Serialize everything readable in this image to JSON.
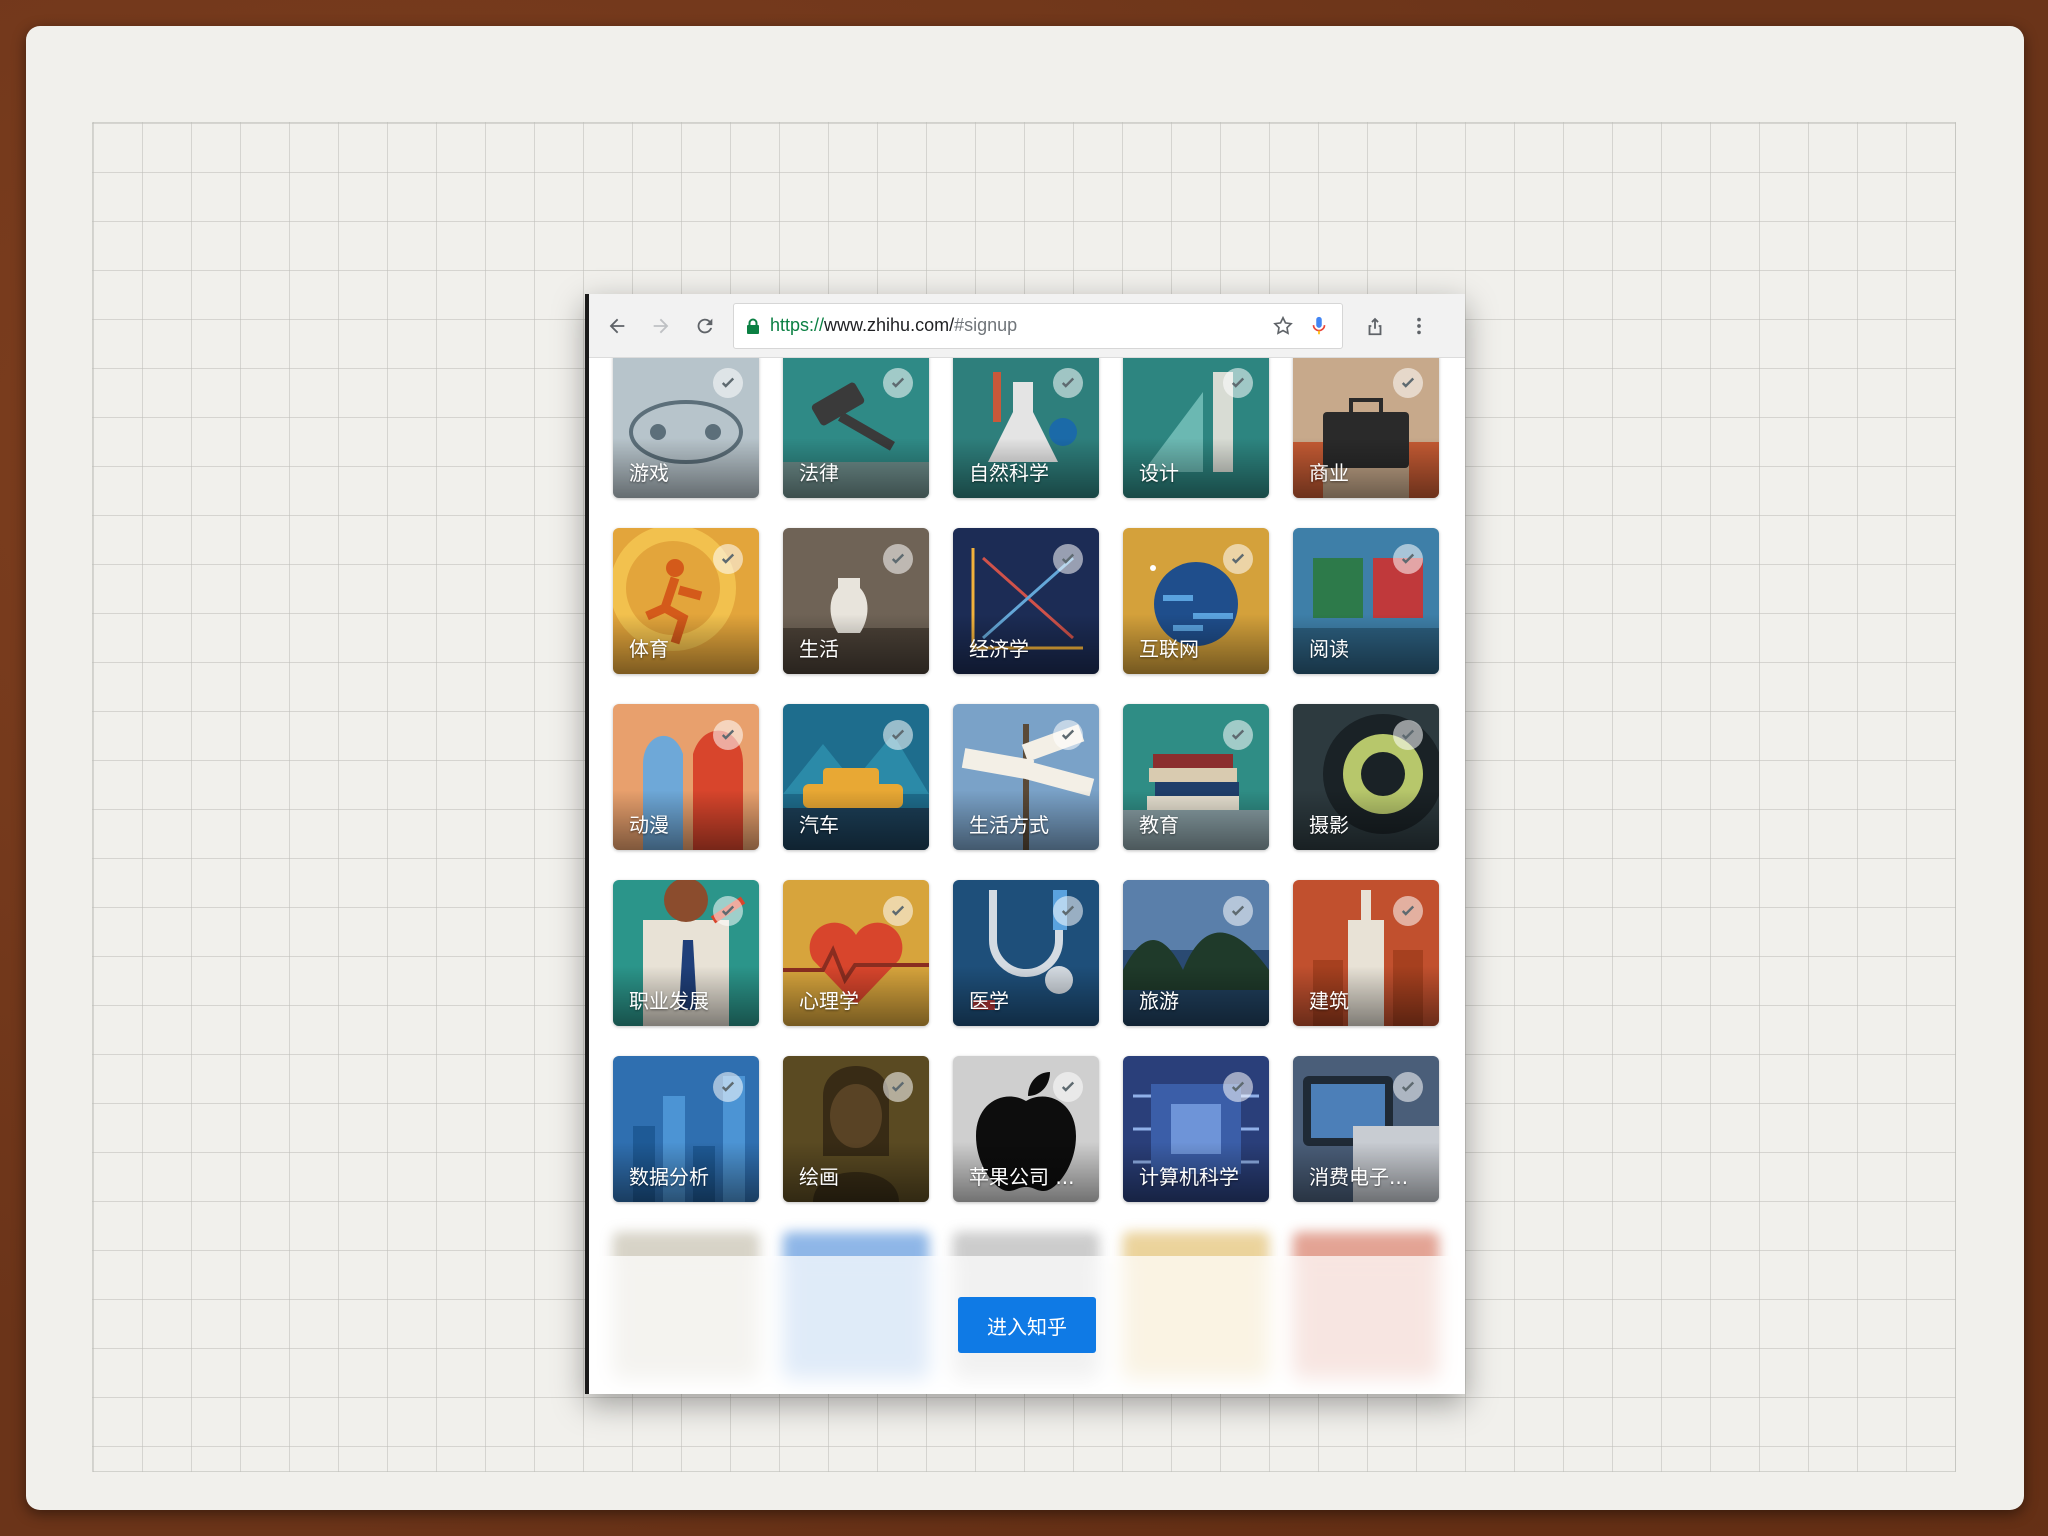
{
  "browser": {
    "url_scheme": "https://",
    "url_host": "www.zhihu.com/",
    "url_path": "#signup"
  },
  "topics": [
    {
      "label": "游戏",
      "bg": "#b7c4cb",
      "icon": "gamepad-icon"
    },
    {
      "label": "法律",
      "bg": "#2f8a86",
      "icon": "gavel-icon"
    },
    {
      "label": "自然科学",
      "bg": "#2e7f7c",
      "icon": "flask-icon"
    },
    {
      "label": "设计",
      "bg": "#2d8580",
      "icon": "ruler-icon"
    },
    {
      "label": "商业",
      "bg": "#c7a98b",
      "icon": "briefcase-icon"
    },
    {
      "label": "体育",
      "bg": "#e3a53b",
      "icon": "runner-icon"
    },
    {
      "label": "生活",
      "bg": "#6f6356",
      "icon": "vase-icon"
    },
    {
      "label": "经济学",
      "bg": "#1c2c55",
      "icon": "supply-demand-icon"
    },
    {
      "label": "互联网",
      "bg": "#d4a13b",
      "icon": "planet-icon"
    },
    {
      "label": "阅读",
      "bg": "#3e7fa8",
      "icon": "reading-icon"
    },
    {
      "label": "动漫",
      "bg": "#e8a06d",
      "icon": "anime-icon"
    },
    {
      "label": "汽车",
      "bg": "#1e6d8d",
      "icon": "car-icon"
    },
    {
      "label": "生活方式",
      "bg": "#7aa2c8",
      "icon": "signpost-icon"
    },
    {
      "label": "教育",
      "bg": "#2f8d85",
      "icon": "books-icon"
    },
    {
      "label": "摄影",
      "bg": "#2d3a3f",
      "icon": "lens-icon"
    },
    {
      "label": "职业发展",
      "bg": "#2b958a",
      "icon": "career-icon"
    },
    {
      "label": "心理学",
      "bg": "#d7a43c",
      "icon": "heart-icon"
    },
    {
      "label": "医学",
      "bg": "#1e4f7a",
      "icon": "stethoscope-icon"
    },
    {
      "label": "旅游",
      "bg": "#2a4a72",
      "icon": "landscape-icon"
    },
    {
      "label": "建筑",
      "bg": "#c1502e",
      "icon": "building-icon"
    },
    {
      "label": "数据分析",
      "bg": "#2f6fb0",
      "icon": "bar-chart-icon"
    },
    {
      "label": "绘画",
      "bg": "#5a4a22",
      "icon": "portrait-icon"
    },
    {
      "label": "苹果公司 ...",
      "bg": "#cfcfcf",
      "icon": "apple-icon"
    },
    {
      "label": "计算机科学",
      "bg": "#2a3f7a",
      "icon": "chip-icon"
    },
    {
      "label": "消费电子...",
      "bg": "#4a5e79",
      "icon": "devices-icon"
    }
  ],
  "footer": {
    "enter_label": "进入知乎"
  },
  "colors": {
    "primary_button": "#0f7ae5",
    "url_secure": "#0b8043"
  }
}
